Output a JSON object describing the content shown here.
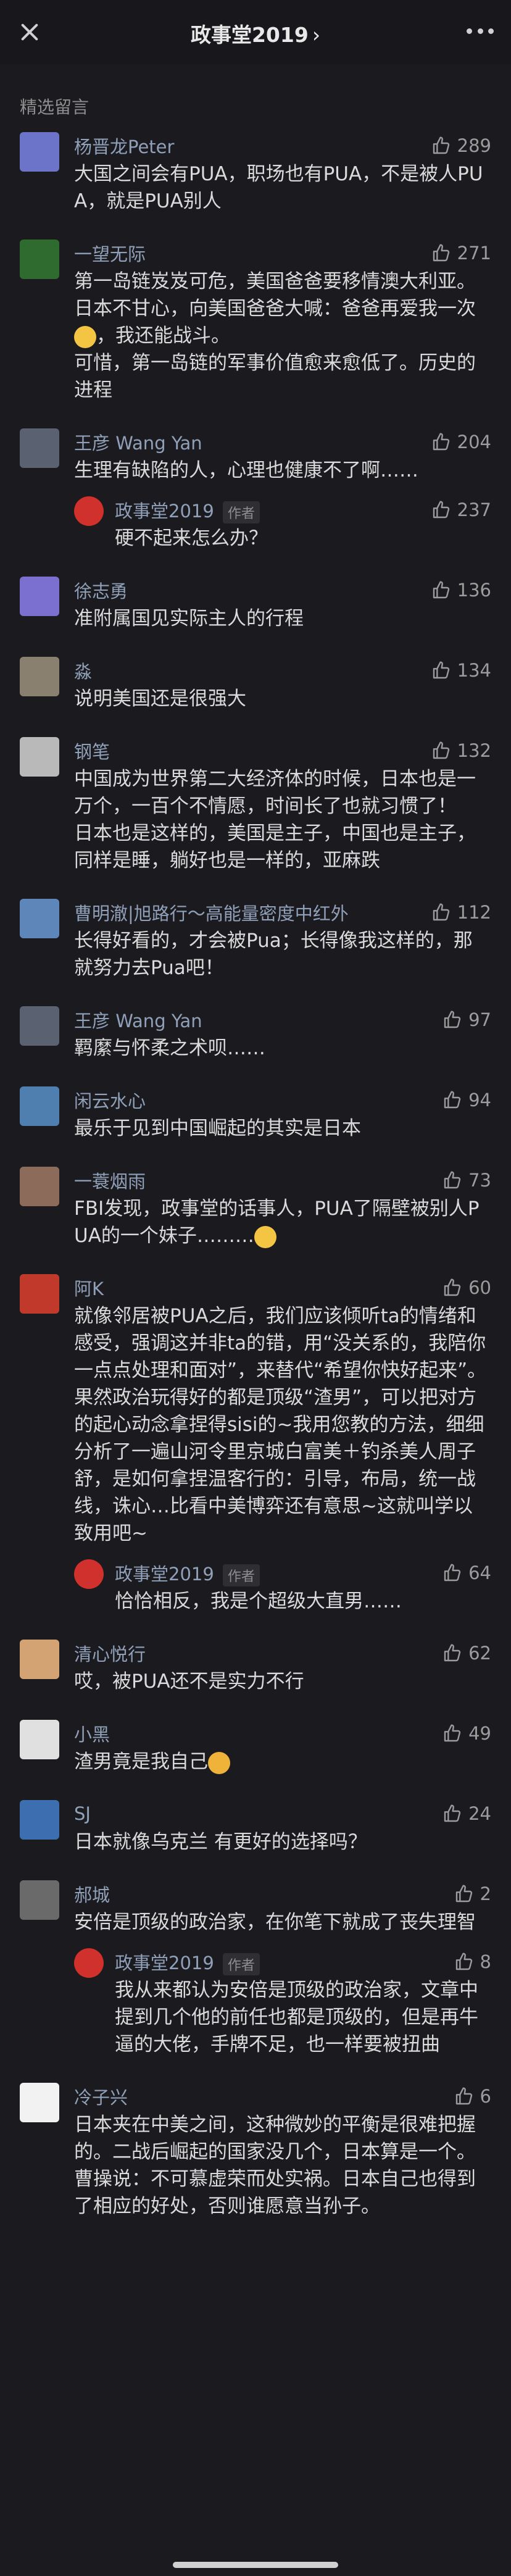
{
  "header": {
    "title": "政事堂2019",
    "title_chevron": "›"
  },
  "section_label": "精选留言",
  "author_tag": "作者",
  "comments": [
    {
      "name": "杨晋龙Peter",
      "likes": "289",
      "text": "大国之间会有PUA，职场也有PUA，不是被人PUA，就是PUA别人",
      "avatar_color": "#6b74c9"
    },
    {
      "name": "一望无际",
      "likes": "271",
      "text": "第一岛链岌岌可危，美国爸爸要移情澳大利亚。日本不甘心，向美国爸爸大喊：爸爸再爱我一次",
      "text2": "，我还能战斗。\n可惜，第一岛链的军事价值愈来愈低了。历史的进程",
      "avatar_color": "#2f6b2f"
    },
    {
      "name": "王彦 Wang Yan",
      "likes": "204",
      "text": "生理有缺陷的人，心理也健康不了啊……",
      "avatar_color": "#5a6272",
      "reply": {
        "name": "政事堂2019",
        "likes": "237",
        "text": "硬不起来怎么办？"
      }
    },
    {
      "name": "徐志勇",
      "likes": "136",
      "text": "准附属国见实际主人的行程",
      "avatar_color": "#7b6fd0"
    },
    {
      "name": "淼",
      "likes": "134",
      "text": "说明美国还是很强大",
      "avatar_color": "#8a8070"
    },
    {
      "name": "钢笔",
      "likes": "132",
      "text": "中国成为世界第二大经济体的时候，日本也是一万个，一百个不情愿，时间长了也就习惯了！\n日本也是这样的，美国是主子，中国也是主子，同样是睡，躺好也是一样的，亚麻跌",
      "avatar_color": "#b9b9b9"
    },
    {
      "name": "曹明澈|旭路行～高能量密度中红外",
      "likes": "112",
      "text": "长得好看的，才会被Pua；长得像我这样的，那就努力去Pua吧！",
      "avatar_color": "#5f86b8"
    },
    {
      "name": "王彦 Wang Yan",
      "likes": "97",
      "text": "羁縻与怀柔之术呗……",
      "avatar_color": "#5a6272"
    },
    {
      "name": "闲云水心",
      "likes": "94",
      "text": "最乐于见到中国崛起的其实是日本",
      "avatar_color": "#4f7fae"
    },
    {
      "name": "一蓑烟雨",
      "likes": "73",
      "text": "FBI发现，政事堂的话事人，PUA了隔壁被别人PUA的一个妹子………",
      "avatar_color": "#8d6b5a"
    },
    {
      "name": "阿K",
      "likes": "60",
      "text": "就像邻居被PUA之后，我们应该倾听ta的情绪和感受，强调这并非ta的错，用“没关系的，我陪你一点点处理和面对”，来替代“希望你快好起来”。\n果然政治玩得好的都是顶级“渣男”，可以把对方的起心动念拿捏得sisi的~我用您教的方法，细细分析了一遍山河令里京城白富美＋钓杀美人周子舒，是如何拿捏温客行的：引导，布局，统一战线，诛心…比看中美博弈还有意思~这就叫学以致用吧~",
      "avatar_color": "#c0392b",
      "reply": {
        "name": "政事堂2019",
        "likes": "64",
        "text": "恰恰相反，我是个超级大直男……"
      }
    },
    {
      "name": "清心悦行",
      "likes": "62",
      "text": "哎，被PUA还不是实力不行",
      "avatar_color": "#d4a373"
    },
    {
      "name": "小黑",
      "likes": "49",
      "text": "渣男竟是我自己",
      "avatar_color": "#e0e0e0"
    },
    {
      "name": "SJ",
      "likes": "24",
      "text": "日本就像乌克兰 有更好的选择吗？",
      "avatar_color": "#3d6fb0"
    },
    {
      "name": "郝城",
      "likes": "2",
      "text": "安倍是顶级的政治家，在你笔下就成了丧失理智",
      "avatar_color": "#6a6a6a",
      "reply": {
        "name": "政事堂2019",
        "likes": "8",
        "text": "我从来都认为安倍是顶级的政治家，文章中提到几个他的前任也都是顶级的，但是再牛逼的大佬，手牌不足，也一样要被扭曲"
      }
    },
    {
      "name": "冷子兴",
      "likes": "6",
      "text": "日本夹在中美之间，这种微妙的平衡是很难把握的。二战后崛起的国家没几个，日本算是一个。曹操说：不可慕虚荣而处实祸。日本自己也得到了相应的好处，否则谁愿意当孙子。",
      "avatar_color": "#f2f2f2"
    }
  ]
}
